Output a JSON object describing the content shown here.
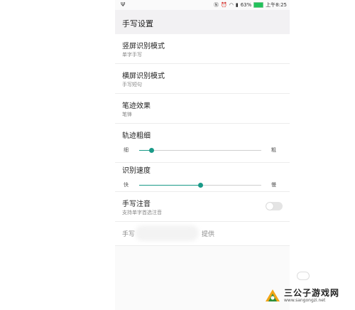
{
  "status_bar": {
    "usb_icon": "usb-icon",
    "battery_percent": "63%",
    "time": "上午8:25",
    "battery_color": "#21c15a"
  },
  "header": {
    "title": "手写设置"
  },
  "settings": {
    "portrait_mode": {
      "label": "竖屏识别模式",
      "value": "单字手写"
    },
    "landscape_mode": {
      "label": "横屏识别模式",
      "value": "手写短句"
    },
    "stroke_effect": {
      "label": "笔迹效果",
      "value": "笔锋"
    },
    "stroke_width": {
      "label": "轨迹粗细",
      "min_label": "细",
      "max_label": "粗",
      "level": 0.1
    },
    "recognition_speed": {
      "label": "识别速度",
      "min_label": "快",
      "max_label": "慢",
      "level": 0.5
    },
    "handwriting_pinyin": {
      "label": "手写注音",
      "description": "支持单字首选注音",
      "enabled": false
    },
    "provider": {
      "label_start": "手写",
      "label_end": "提供"
    }
  },
  "accent_color": "#1a9a88",
  "watermark": {
    "title": "三公子游戏网",
    "url": "www.sangongzi.net"
  }
}
